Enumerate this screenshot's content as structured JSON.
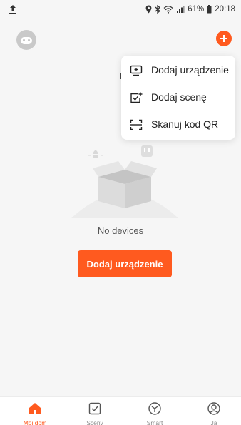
{
  "status_bar": {
    "battery": "61%",
    "time": "20:18"
  },
  "header": {
    "partial_text": "I"
  },
  "menu": {
    "items": [
      {
        "label": "Dodaj urządzenie",
        "icon": "add-device-icon"
      },
      {
        "label": "Dodaj scenę",
        "icon": "add-scene-icon"
      },
      {
        "label": "Skanuj kod QR",
        "icon": "scan-qr-icon"
      }
    ]
  },
  "empty_state": {
    "message": "No devices",
    "button": "Dodaj urządzenie"
  },
  "bottom_nav": {
    "items": [
      {
        "label": "Mój dom",
        "icon": "home-icon",
        "active": true
      },
      {
        "label": "Sceny",
        "icon": "scene-icon",
        "active": false
      },
      {
        "label": "Smart",
        "icon": "smart-icon",
        "active": false
      },
      {
        "label": "Ja",
        "icon": "profile-icon",
        "active": false
      }
    ]
  },
  "colors": {
    "accent": "#ff5a1f",
    "background": "#f6f6f6",
    "menu_bg": "#ffffff"
  }
}
